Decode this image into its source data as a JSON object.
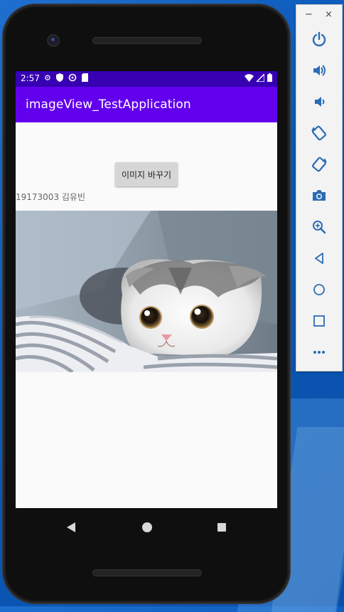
{
  "status_bar": {
    "time": "2:57"
  },
  "app": {
    "title": "imageView_TestApplication",
    "change_button_label": "이미지 바꾸기",
    "student_label": "19173003 김유빈"
  },
  "colors": {
    "status_bar": "#3700b3",
    "app_bar": "#6200ee",
    "screen_bg": "#fafafa",
    "button_bg": "#d6d6d6"
  },
  "emulator_panel": {
    "window_controls": [
      "−",
      "×"
    ],
    "buttons": [
      "power-icon",
      "volume-up-icon",
      "volume-down-icon",
      "rotate-left-icon",
      "rotate-right-icon",
      "camera-icon",
      "zoom-icon",
      "back-icon",
      "home-icon",
      "overview-icon",
      "more-icon"
    ]
  }
}
